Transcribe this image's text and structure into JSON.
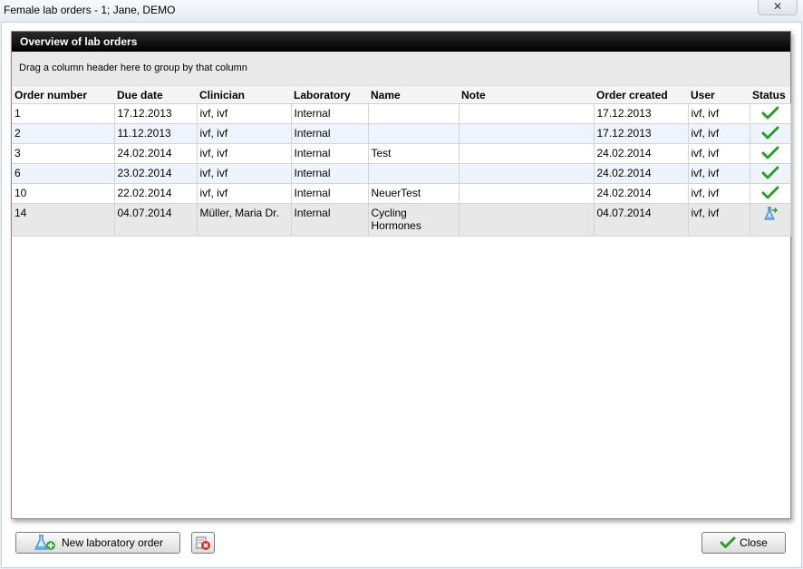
{
  "window": {
    "title": "Female lab orders - 1; Jane, DEMO",
    "close_glyph": "✕"
  },
  "panel": {
    "title": "Overview of lab orders",
    "group_hint": "Drag a column header here to group by that column"
  },
  "table": {
    "columns": [
      "Order number",
      "Due date",
      "Clinician",
      "Laboratory",
      "Name",
      "Note",
      "Order created",
      "User",
      "Status"
    ],
    "rows": [
      {
        "order": "1",
        "due": "17.12.2013",
        "clinician": "ivf, ivf",
        "lab": "Internal",
        "name": "",
        "note": "",
        "created": "17.12.2013",
        "user": "ivf, ivf",
        "status": "done-check-icon"
      },
      {
        "order": "2",
        "due": "11.12.2013",
        "clinician": "ivf, ivf",
        "lab": "Internal",
        "name": "",
        "note": "",
        "created": "17.12.2013",
        "user": "ivf, ivf",
        "status": "done-check-icon"
      },
      {
        "order": "3",
        "due": "24.02.2014",
        "clinician": "ivf, ivf",
        "lab": "Internal",
        "name": "Test",
        "note": "",
        "created": "24.02.2014",
        "user": "ivf, ivf",
        "status": "done-check-icon"
      },
      {
        "order": "6",
        "due": "23.02.2014",
        "clinician": "ivf, ivf",
        "lab": "Internal",
        "name": "",
        "note": "",
        "created": "24.02.2014",
        "user": "ivf, ivf",
        "status": "done-check-icon"
      },
      {
        "order": "10",
        "due": "22.02.2014",
        "clinician": "ivf, ivf",
        "lab": "Internal",
        "name": "NeuerTest",
        "note": "",
        "created": "24.02.2014",
        "user": "ivf, ivf",
        "status": "done-check-icon"
      },
      {
        "order": "14",
        "due": "04.07.2014",
        "clinician": "Müller, Maria Dr.",
        "lab": "Internal",
        "name": "Cycling Hormones",
        "note": "",
        "created": "04.07.2014",
        "user": "ivf, ivf",
        "status": "flask-sent-icon"
      }
    ]
  },
  "buttons": {
    "new_order": "New laboratory order",
    "close": "Close"
  },
  "colors": {
    "check_green": "#2e9a2e",
    "header_black": "#000000",
    "flask_blue": "#3d7fc4"
  }
}
